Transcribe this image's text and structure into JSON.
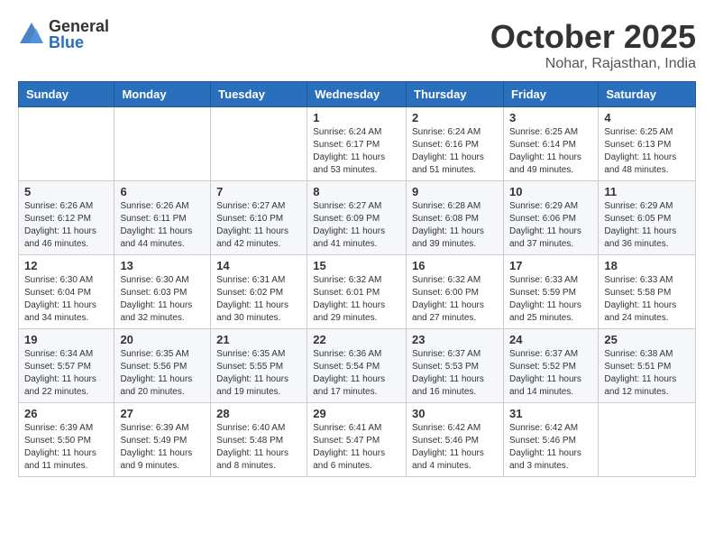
{
  "logo": {
    "general": "General",
    "blue": "Blue"
  },
  "header": {
    "month": "October 2025",
    "location": "Nohar, Rajasthan, India"
  },
  "weekdays": [
    "Sunday",
    "Monday",
    "Tuesday",
    "Wednesday",
    "Thursday",
    "Friday",
    "Saturday"
  ],
  "weeks": [
    [
      {
        "day": "",
        "info": ""
      },
      {
        "day": "",
        "info": ""
      },
      {
        "day": "",
        "info": ""
      },
      {
        "day": "1",
        "info": "Sunrise: 6:24 AM\nSunset: 6:17 PM\nDaylight: 11 hours\nand 53 minutes."
      },
      {
        "day": "2",
        "info": "Sunrise: 6:24 AM\nSunset: 6:16 PM\nDaylight: 11 hours\nand 51 minutes."
      },
      {
        "day": "3",
        "info": "Sunrise: 6:25 AM\nSunset: 6:14 PM\nDaylight: 11 hours\nand 49 minutes."
      },
      {
        "day": "4",
        "info": "Sunrise: 6:25 AM\nSunset: 6:13 PM\nDaylight: 11 hours\nand 48 minutes."
      }
    ],
    [
      {
        "day": "5",
        "info": "Sunrise: 6:26 AM\nSunset: 6:12 PM\nDaylight: 11 hours\nand 46 minutes."
      },
      {
        "day": "6",
        "info": "Sunrise: 6:26 AM\nSunset: 6:11 PM\nDaylight: 11 hours\nand 44 minutes."
      },
      {
        "day": "7",
        "info": "Sunrise: 6:27 AM\nSunset: 6:10 PM\nDaylight: 11 hours\nand 42 minutes."
      },
      {
        "day": "8",
        "info": "Sunrise: 6:27 AM\nSunset: 6:09 PM\nDaylight: 11 hours\nand 41 minutes."
      },
      {
        "day": "9",
        "info": "Sunrise: 6:28 AM\nSunset: 6:08 PM\nDaylight: 11 hours\nand 39 minutes."
      },
      {
        "day": "10",
        "info": "Sunrise: 6:29 AM\nSunset: 6:06 PM\nDaylight: 11 hours\nand 37 minutes."
      },
      {
        "day": "11",
        "info": "Sunrise: 6:29 AM\nSunset: 6:05 PM\nDaylight: 11 hours\nand 36 minutes."
      }
    ],
    [
      {
        "day": "12",
        "info": "Sunrise: 6:30 AM\nSunset: 6:04 PM\nDaylight: 11 hours\nand 34 minutes."
      },
      {
        "day": "13",
        "info": "Sunrise: 6:30 AM\nSunset: 6:03 PM\nDaylight: 11 hours\nand 32 minutes."
      },
      {
        "day": "14",
        "info": "Sunrise: 6:31 AM\nSunset: 6:02 PM\nDaylight: 11 hours\nand 30 minutes."
      },
      {
        "day": "15",
        "info": "Sunrise: 6:32 AM\nSunset: 6:01 PM\nDaylight: 11 hours\nand 29 minutes."
      },
      {
        "day": "16",
        "info": "Sunrise: 6:32 AM\nSunset: 6:00 PM\nDaylight: 11 hours\nand 27 minutes."
      },
      {
        "day": "17",
        "info": "Sunrise: 6:33 AM\nSunset: 5:59 PM\nDaylight: 11 hours\nand 25 minutes."
      },
      {
        "day": "18",
        "info": "Sunrise: 6:33 AM\nSunset: 5:58 PM\nDaylight: 11 hours\nand 24 minutes."
      }
    ],
    [
      {
        "day": "19",
        "info": "Sunrise: 6:34 AM\nSunset: 5:57 PM\nDaylight: 11 hours\nand 22 minutes."
      },
      {
        "day": "20",
        "info": "Sunrise: 6:35 AM\nSunset: 5:56 PM\nDaylight: 11 hours\nand 20 minutes."
      },
      {
        "day": "21",
        "info": "Sunrise: 6:35 AM\nSunset: 5:55 PM\nDaylight: 11 hours\nand 19 minutes."
      },
      {
        "day": "22",
        "info": "Sunrise: 6:36 AM\nSunset: 5:54 PM\nDaylight: 11 hours\nand 17 minutes."
      },
      {
        "day": "23",
        "info": "Sunrise: 6:37 AM\nSunset: 5:53 PM\nDaylight: 11 hours\nand 16 minutes."
      },
      {
        "day": "24",
        "info": "Sunrise: 6:37 AM\nSunset: 5:52 PM\nDaylight: 11 hours\nand 14 minutes."
      },
      {
        "day": "25",
        "info": "Sunrise: 6:38 AM\nSunset: 5:51 PM\nDaylight: 11 hours\nand 12 minutes."
      }
    ],
    [
      {
        "day": "26",
        "info": "Sunrise: 6:39 AM\nSunset: 5:50 PM\nDaylight: 11 hours\nand 11 minutes."
      },
      {
        "day": "27",
        "info": "Sunrise: 6:39 AM\nSunset: 5:49 PM\nDaylight: 11 hours\nand 9 minutes."
      },
      {
        "day": "28",
        "info": "Sunrise: 6:40 AM\nSunset: 5:48 PM\nDaylight: 11 hours\nand 8 minutes."
      },
      {
        "day": "29",
        "info": "Sunrise: 6:41 AM\nSunset: 5:47 PM\nDaylight: 11 hours\nand 6 minutes."
      },
      {
        "day": "30",
        "info": "Sunrise: 6:42 AM\nSunset: 5:46 PM\nDaylight: 11 hours\nand 4 minutes."
      },
      {
        "day": "31",
        "info": "Sunrise: 6:42 AM\nSunset: 5:46 PM\nDaylight: 11 hours\nand 3 minutes."
      },
      {
        "day": "",
        "info": ""
      }
    ]
  ]
}
